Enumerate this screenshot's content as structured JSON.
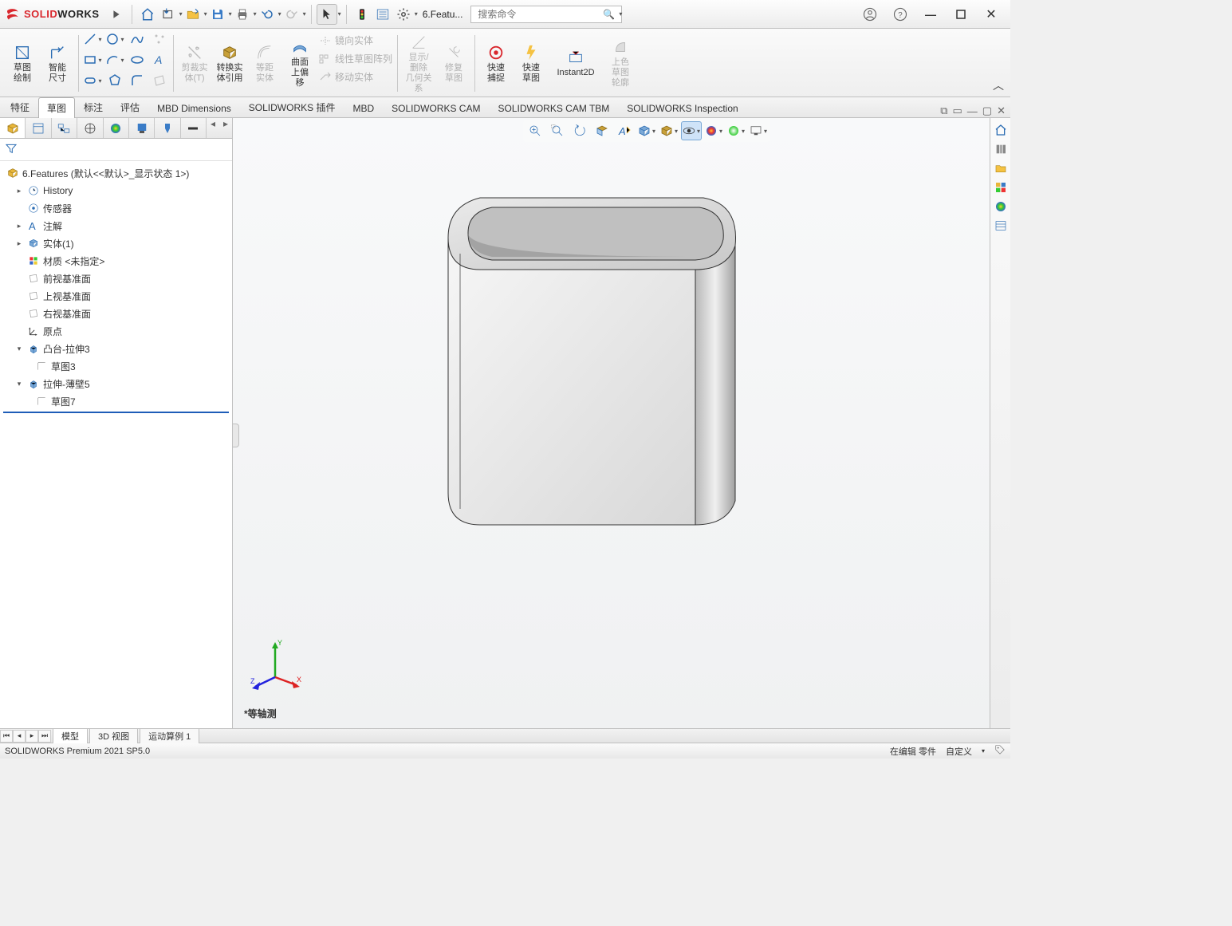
{
  "titlebar": {
    "brand1": "SOLID",
    "brand2": "WORKS",
    "doc_title": "6.Featu...",
    "search_placeholder": "搜索命令"
  },
  "ribbon": {
    "sketch_draw": "草图\n绘制",
    "smart_dim": "智能\n尺寸",
    "trim": "剪裁实\n体(T)",
    "convert": "转换实\n体引用",
    "offset_entity": "等距\n实体",
    "surface_offset": "曲面\n上偏\n移",
    "mirror": "镜向实体",
    "linear_pattern": "线性草图阵列",
    "move": "移动实体",
    "display_rel": "显示/删除\n几何关系",
    "repair": "修复\n草图",
    "quick_snap": "快速\n捕捉",
    "quick_sketch": "快速\n草图",
    "instant2d": "Instant2D",
    "shade_outline": "上色\n草图\n轮廓"
  },
  "tabs": [
    "特征",
    "草图",
    "标注",
    "评估",
    "MBD Dimensions",
    "SOLIDWORKS 插件",
    "MBD",
    "SOLIDWORKS CAM",
    "SOLIDWORKS CAM TBM",
    "SOLIDWORKS Inspection"
  ],
  "tree": {
    "root": "6.Features  (默认<<默认>_显示状态 1>)",
    "history": "History",
    "sensors": "传感器",
    "annotations": "注解",
    "solid_bodies": "实体(1)",
    "material": "材质 <未指定>",
    "front_plane": "前视基准面",
    "top_plane": "上视基准面",
    "right_plane": "右视基准面",
    "origin": "原点",
    "extrude": "凸台-拉伸3",
    "sketch3": "草图3",
    "thin_extrude": "拉伸-薄壁5",
    "sketch7": "草图7"
  },
  "viewport": {
    "view_label": "*等轴测",
    "triad": {
      "x": "X",
      "y": "Y",
      "z": "Z"
    }
  },
  "bottom_tabs": [
    "模型",
    "3D 视图",
    "运动算例 1"
  ],
  "statusbar": {
    "product": "SOLIDWORKS Premium 2021 SP5.0",
    "editing": "在编辑 零件",
    "custom": "自定义"
  }
}
